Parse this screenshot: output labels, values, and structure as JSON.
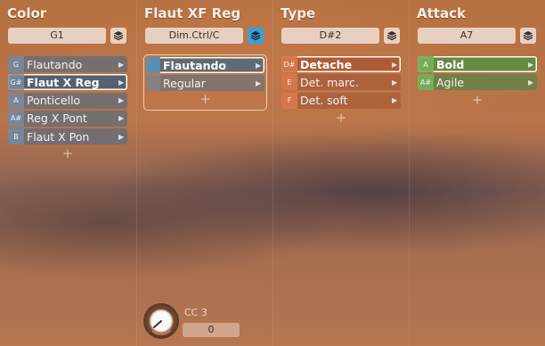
{
  "columns": [
    {
      "title": "Color",
      "selector": "G1",
      "layer_active": false,
      "items": [
        {
          "key": "G",
          "label": "Flautando",
          "selected": false
        },
        {
          "key": "G#",
          "label": "Flaut X Reg",
          "selected": true
        },
        {
          "key": "A",
          "label": "Ponticello",
          "selected": false
        },
        {
          "key": "A#",
          "label": "Reg X Pont",
          "selected": false
        },
        {
          "key": "B",
          "label": "Flaut X Pon",
          "selected": false
        }
      ]
    },
    {
      "title": "Flaut XF Reg",
      "selector": "Dim.Ctrl/C",
      "layer_active": true,
      "items": [
        {
          "key": "",
          "label": "Flautando",
          "selected": true
        },
        {
          "key": "",
          "label": "Regular",
          "selected": false
        }
      ]
    },
    {
      "title": "Type",
      "selector": "D#2",
      "layer_active": false,
      "items": [
        {
          "key": "D#",
          "label": "Detache",
          "selected": true
        },
        {
          "key": "E",
          "label": "Det. marc.",
          "selected": false
        },
        {
          "key": "F",
          "label": "Det. soft",
          "selected": false
        }
      ]
    },
    {
      "title": "Attack",
      "selector": "A7",
      "layer_active": false,
      "items": [
        {
          "key": "A",
          "label": "Bold",
          "selected": true
        },
        {
          "key": "A#",
          "label": "Agile",
          "selected": false
        }
      ]
    }
  ],
  "add_symbol": "+",
  "controller": {
    "label": "CC 3",
    "value": "0",
    "level": 0
  },
  "icons": {
    "layer": "layers-icon",
    "arrow": "chevron-right-icon",
    "knob": "knob-icon"
  },
  "colors": {
    "layer_active": "#3aa0d8",
    "color_group": "#6e8296",
    "type_group": "#d7784b",
    "attack_group": "#78af5a"
  }
}
